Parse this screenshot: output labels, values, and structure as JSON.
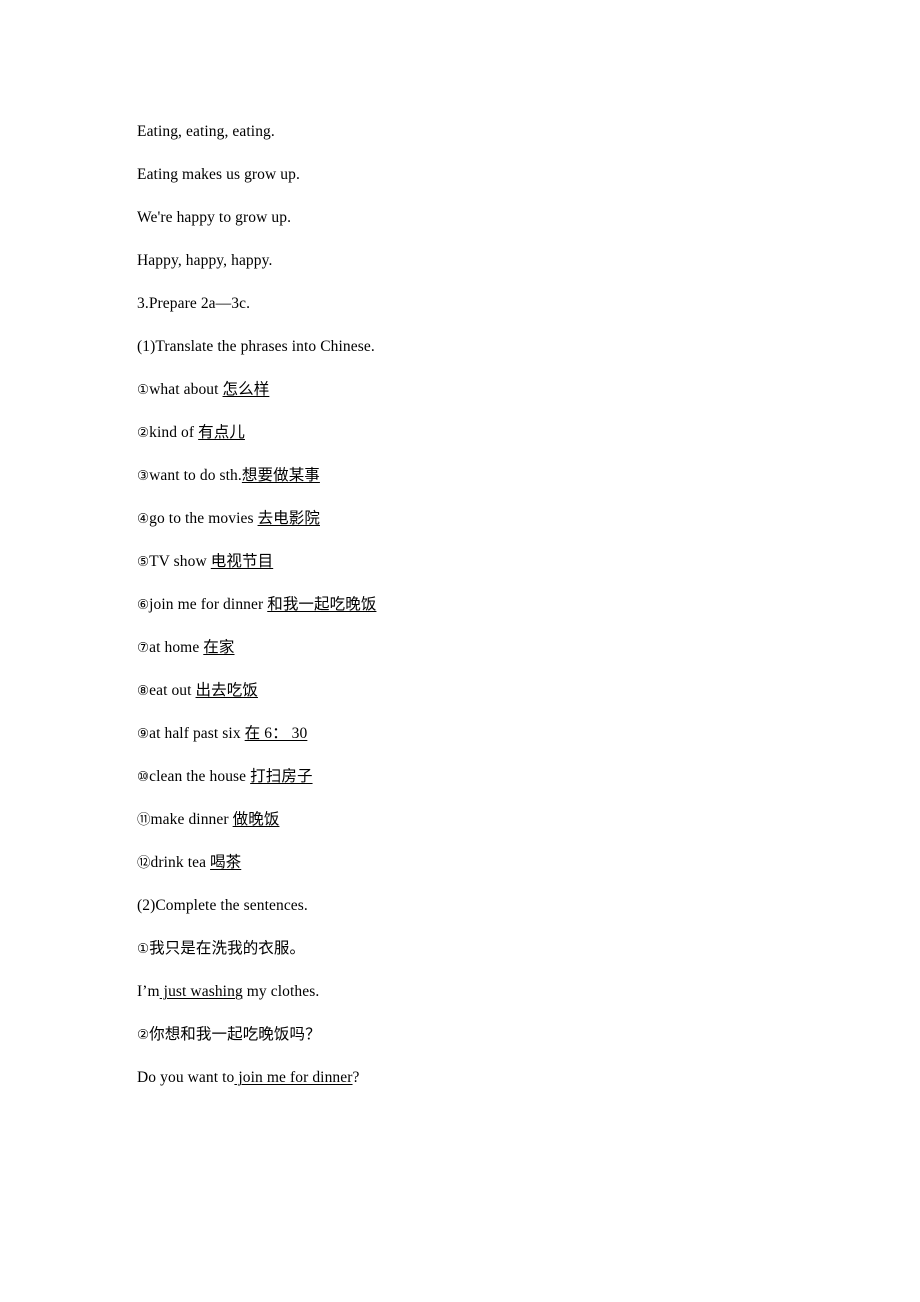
{
  "document": {
    "page_background": "#ffffff",
    "text_color": "#000000",
    "lines": [
      {
        "id": "l1",
        "text": "Eating, eating, eating."
      },
      {
        "id": "l2",
        "text": "Eating makes us grow up."
      },
      {
        "id": "l3",
        "text": "We're happy to grow up."
      },
      {
        "id": "l4",
        "text": "Happy, happy, happy."
      },
      {
        "id": "l5",
        "text": "3.Prepare 2a—3c."
      },
      {
        "id": "l6",
        "text": "(1)Translate the phrases into Chinese."
      }
    ],
    "section_translate": {
      "heading": "(1)Translate the phrases into Chinese.",
      "items": [
        {
          "marker": "①",
          "prompt": "what about ",
          "answer": "怎么样"
        },
        {
          "marker": "②",
          "prompt": "kind of ",
          "answer": "有点儿"
        },
        {
          "marker": "③",
          "prompt": "want to do sth.",
          "answer": "想要做某事"
        },
        {
          "marker": "④",
          "prompt": "go to the movies ",
          "answer": "去电影院"
        },
        {
          "marker": "⑤",
          "prompt": "TV show ",
          "answer": "电视节目"
        },
        {
          "marker": "⑥",
          "prompt": "join me for dinner ",
          "answer": "和我一起吃晚饭"
        },
        {
          "marker": "⑦",
          "prompt": "at home ",
          "answer": "在家"
        },
        {
          "marker": "⑧",
          "prompt": "eat out ",
          "answer": "出去吃饭"
        },
        {
          "marker": "⑨",
          "prompt": "at half past six ",
          "answer": "在  6：  30"
        },
        {
          "marker": "⑩",
          "prompt": "clean the house ",
          "answer": "打扫房子"
        },
        {
          "marker": "⑪",
          "prompt": "make dinner ",
          "answer": "做晚饭"
        },
        {
          "marker": "⑫",
          "prompt": "drink tea ",
          "answer": "喝茶"
        }
      ]
    },
    "section_complete": {
      "heading": "(2)Complete the sentences.",
      "items": [
        {
          "marker": "①",
          "chinese": "我只是在洗我的衣服。",
          "answer_prefix": "I’m",
          "answer_blank": " just washing",
          "answer_suffix": " my clothes."
        },
        {
          "marker": "②",
          "chinese": "你想和我一起吃晚饭吗？",
          "answer_prefix": "Do you want to",
          "answer_blank": " join me for dinner",
          "answer_suffix": "?"
        }
      ]
    }
  }
}
